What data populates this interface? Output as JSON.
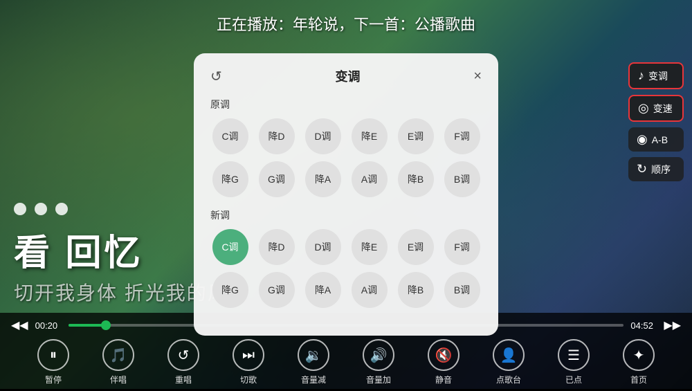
{
  "nowPlaying": {
    "text": "正在播放：年轮说，下一首：公播歌曲"
  },
  "lyrics": {
    "mainText": "看 回忆",
    "subText": "切开我身体 折光我的风雨",
    "dots": 3
  },
  "progress": {
    "current": "00:20",
    "total": "04:52",
    "percent": 6.8
  },
  "controls": [
    {
      "id": "pause",
      "icon": "⏸",
      "label": "暂停"
    },
    {
      "id": "accompany",
      "icon": "🎵",
      "label": "伴唱"
    },
    {
      "id": "replay",
      "icon": "↺",
      "label": "重唱"
    },
    {
      "id": "next",
      "icon": "⏭",
      "label": "切歌"
    },
    {
      "id": "vol-down",
      "icon": "🔉",
      "label": "音量减"
    },
    {
      "id": "vol-up",
      "icon": "🔊",
      "label": "音量加"
    },
    {
      "id": "mute",
      "icon": "🔇",
      "label": "静音"
    },
    {
      "id": "songlist",
      "icon": "👤",
      "label": "点歌台"
    },
    {
      "id": "queued",
      "icon": "☰",
      "label": "已点"
    },
    {
      "id": "home",
      "icon": "✦",
      "label": "首页"
    }
  ],
  "rightPanel": [
    {
      "id": "pitch",
      "label": "变调",
      "icon": "♪",
      "active": true
    },
    {
      "id": "speed",
      "label": "变速",
      "icon": "◎",
      "active": true
    },
    {
      "id": "ab",
      "label": "A-B",
      "icon": "◉",
      "active": false
    },
    {
      "id": "order",
      "label": "顺序",
      "icon": "↻",
      "active": false
    }
  ],
  "modal": {
    "title": "变调",
    "refreshIcon": "↺",
    "closeIcon": "×",
    "sections": [
      {
        "id": "original",
        "label": "原调",
        "keys": [
          "C调",
          "降D",
          "D调",
          "降E",
          "E调",
          "F调",
          "降G",
          "G调",
          "降A",
          "A调",
          "降B",
          "B调"
        ],
        "selected": null
      },
      {
        "id": "new",
        "label": "新调",
        "keys": [
          "C调",
          "降D",
          "D调",
          "降E",
          "E调",
          "F调",
          "降G",
          "G调",
          "降A",
          "A调",
          "降B",
          "B调"
        ],
        "selected": "C调"
      }
    ]
  }
}
